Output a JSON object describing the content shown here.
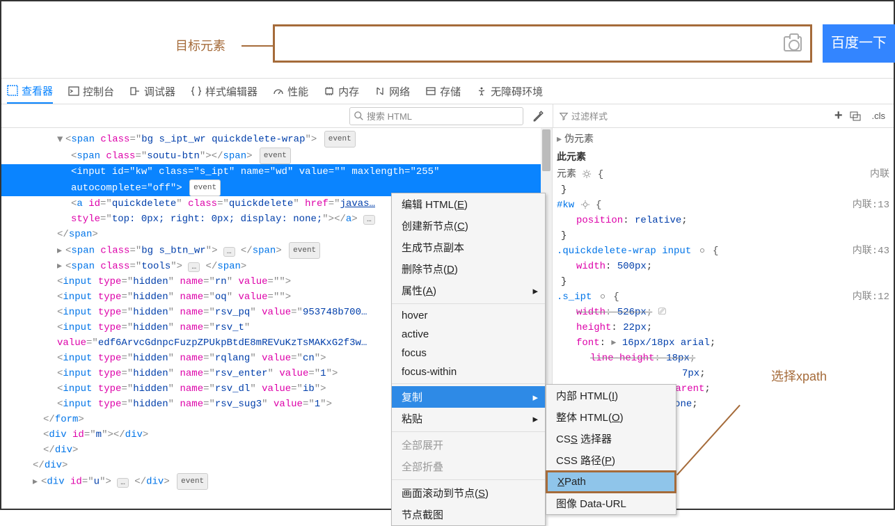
{
  "top": {
    "target_label": "目标元素",
    "search_button": "百度一下"
  },
  "tabs": [
    {
      "label": "查看器",
      "active": true
    },
    {
      "label": "控制台"
    },
    {
      "label": "调试器"
    },
    {
      "label": "样式编辑器"
    },
    {
      "label": "性能"
    },
    {
      "label": "内存"
    },
    {
      "label": "网络"
    },
    {
      "label": "存储"
    },
    {
      "label": "无障碍环境"
    }
  ],
  "toolbar": {
    "search_html_ph": "搜索 HTML",
    "filter_styles_ph": "过滤样式",
    "cls": ".cls"
  },
  "dom": {
    "l0": "<span class=\"bg s_ipt_wr quickdelete-wrap\">",
    "l1": "<span class=\"soutu-btn\"></span>",
    "l2a": "<input id=\"kw\" class=\"s_ipt\" name=\"wd\" value=\"\" maxlength=\"255\"",
    "l2b": "autocomplete=\"off\">",
    "l3a": "<a id=\"quickdelete\" class=\"quickdelete\" href=\"javas…",
    "l3b": "style=\"top: 0px; right: 0px; display: none;\"></a>",
    "l4": "</span>",
    "l5": "<span class=\"bg s_btn_wr\"> … </span>",
    "l6": "<span class=\"tools\"> … </span>",
    "l7": "<input type=\"hidden\" name=\"rn\" value=\"\">",
    "l8": "<input type=\"hidden\" name=\"oq\" value=\"\">",
    "l9": "<input type=\"hidden\" name=\"rsv_pq\" value=\"953748b700…",
    "l10a": "<input type=\"hidden\" name=\"rsv_t\"",
    "l10b": "value=\"edf6ArvcGdnpcFuzpZPUkpBtdE8mREVuKzTsMAKxG2f3w…",
    "l11": "<input type=\"hidden\" name=\"rqlang\" value=\"cn\">",
    "l12": "<input type=\"hidden\" name=\"rsv_enter\" value=\"1\">",
    "l13": "<input type=\"hidden\" name=\"rsv_dl\" value=\"ib\">",
    "l14": "<input type=\"hidden\" name=\"rsv_sug3\" value=\"1\">",
    "l15": "</form>",
    "l16": "<div id=\"m\"></div>",
    "l17": "</div>",
    "l18": "</div>",
    "l19": "<div id=\"u\"> … </div>",
    "event": "event"
  },
  "ctx": {
    "edit_html": "编辑 HTML(",
    "edit_html_u": "E",
    "edit_html_e": ")",
    "create_node": "创建新节点(",
    "create_node_u": "C",
    "create_node_e": ")",
    "gen_copy": "生成节点副本",
    "del_node": "删除节点(",
    "del_node_u": "D",
    "del_node_e": ")",
    "attrs": "属性(",
    "attrs_u": "A",
    "attrs_e": ")",
    "hover": "hover",
    "active": "active",
    "focus": "focus",
    "focuswithin": "focus-within",
    "copy": "复制",
    "paste": "粘贴",
    "expand": "全部展开",
    "collapse": "全部折叠",
    "scroll": "画面滚动到节点(",
    "scroll_u": "S",
    "scroll_e": ")",
    "snapshot": "节点截图"
  },
  "submenu": {
    "inner": "内部 HTML(",
    "inner_u": "I",
    "inner_e": ")",
    "outer": "整体 HTML(",
    "outer_u": "O",
    "outer_e": ")",
    "csssel": "CS",
    "csssel_u": "S",
    "csssel_e": " 选择器",
    "csspath": "CSS 路径(",
    "csspath_u": "P",
    "csspath_e": ")",
    "xpath_u": "X",
    "xpath": "Path",
    "imgurl": "图像 Data-URL"
  },
  "styles": {
    "pseudo": "伪元素",
    "this_el": "此元素",
    "element": "元素",
    "inline": "内联",
    "kw_sel": "#kw",
    "kw_line": "内联:13",
    "kw_pos": "position",
    "kw_pos_v": "relative",
    "qd_sel": ".quickdelete-wrap input",
    "qd_line": "内联:43",
    "qd_w": "width",
    "qd_w_v": "500px",
    "ipt_sel": ".s_ipt",
    "ipt_line": "内联:12",
    "ipt_w": "width",
    "ipt_w_v": "526px",
    "ipt_h": "height",
    "ipt_h_v": "22px",
    "ipt_font": "font",
    "ipt_font_v": "16px/18px arial",
    "ipt_lh": "line-height",
    "ipt_lh_v": "18px",
    "ipt_px": "7px",
    "ipt_trans": "transparent",
    "ipt_none": "none"
  },
  "xpath_label": "选择xpath"
}
